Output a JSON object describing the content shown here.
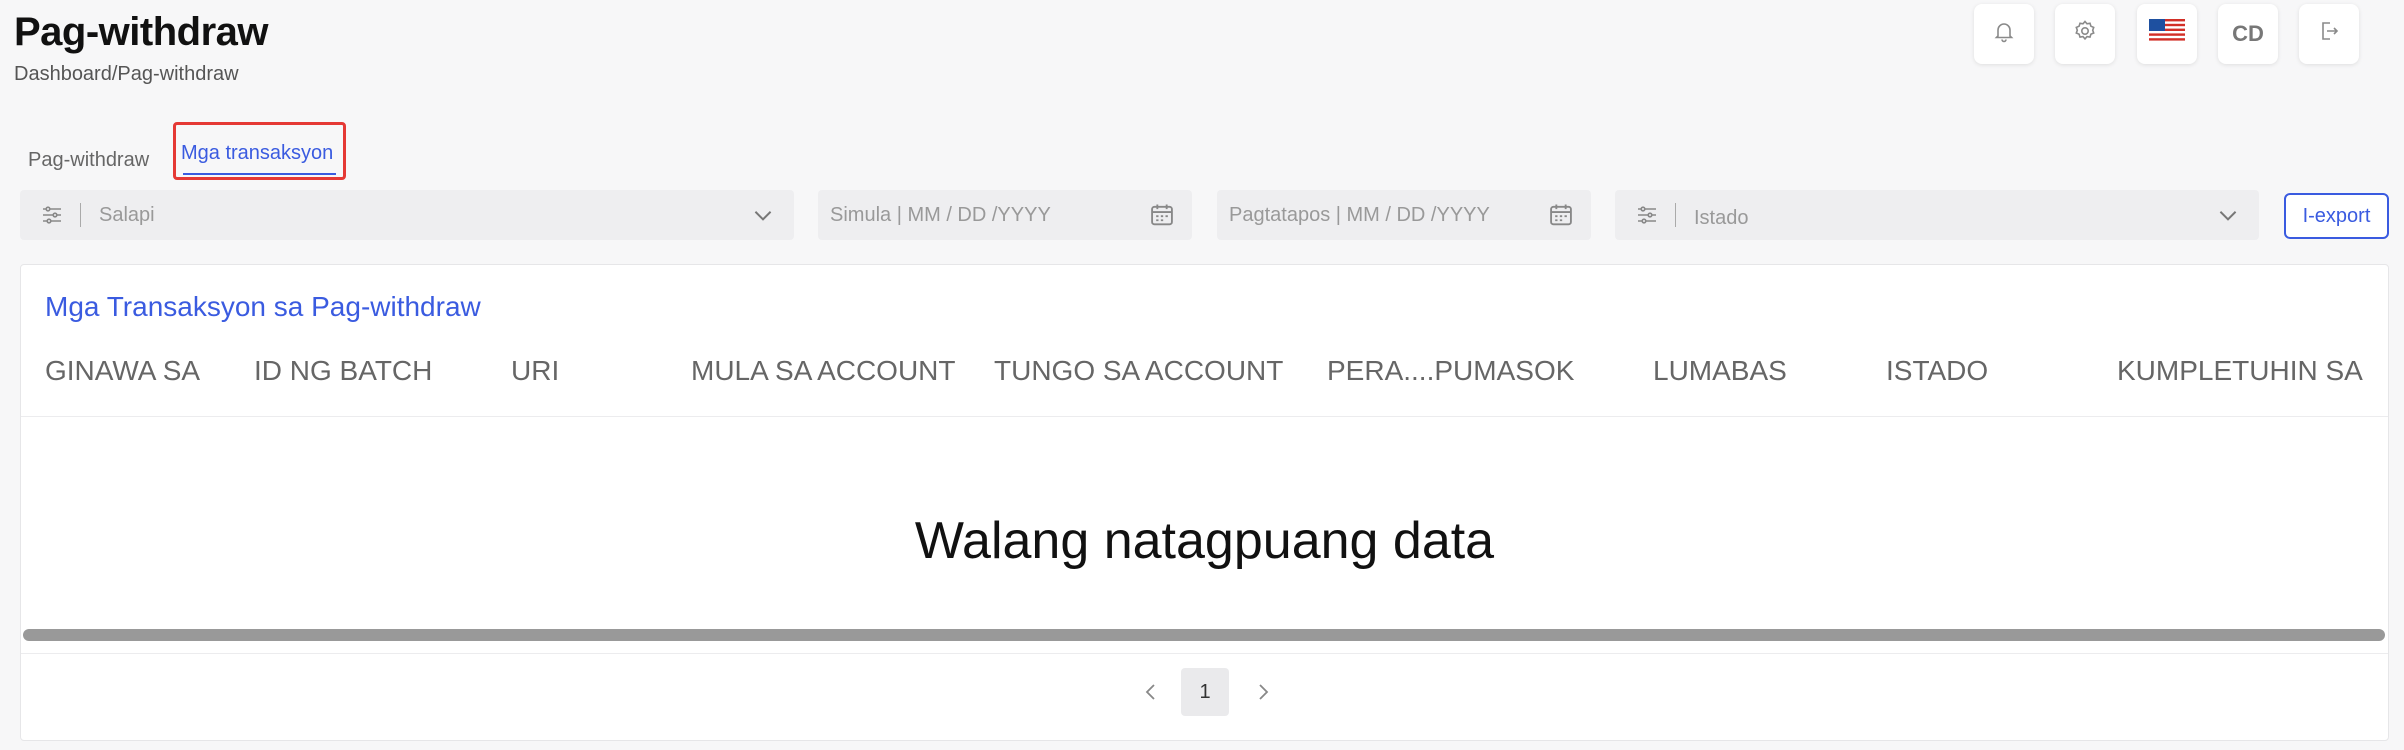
{
  "header": {
    "title": "Pag-withdraw",
    "breadcrumb": "Dashboard/Pag-withdraw",
    "avatar_initials": "CD",
    "icons": [
      "bell-icon",
      "gear-icon",
      "us-flag-icon",
      "avatar",
      "logout-icon"
    ]
  },
  "tabs": [
    {
      "label": "Pag-withdraw",
      "active": false
    },
    {
      "label": "Mga transaksyon",
      "active": true
    }
  ],
  "filters": {
    "currency_placeholder": "Salapi",
    "start_placeholder": "Simula | MM / DD /YYYY",
    "end_placeholder": "Pagtatapos | MM / DD /YYYY",
    "status_placeholder": "Istado",
    "export_label": "I-export"
  },
  "table": {
    "title": "Mga Transaksyon sa Pag-withdraw",
    "columns": [
      "GINAWA SA",
      "ID NG BATCH",
      "URI",
      "MULA SA ACCOUNT",
      "TUNGO SA ACCOUNT",
      "PERA....PUMASOK",
      "LUMABAS",
      "ISTADO",
      "KUMPLETUHIN SA"
    ],
    "empty_text": "Walang natagpuang data"
  },
  "pagination": {
    "current_page": "1"
  },
  "colors": {
    "accent": "#3a5be0",
    "highlight_border": "#e53935",
    "background": "#f7f7f8"
  }
}
